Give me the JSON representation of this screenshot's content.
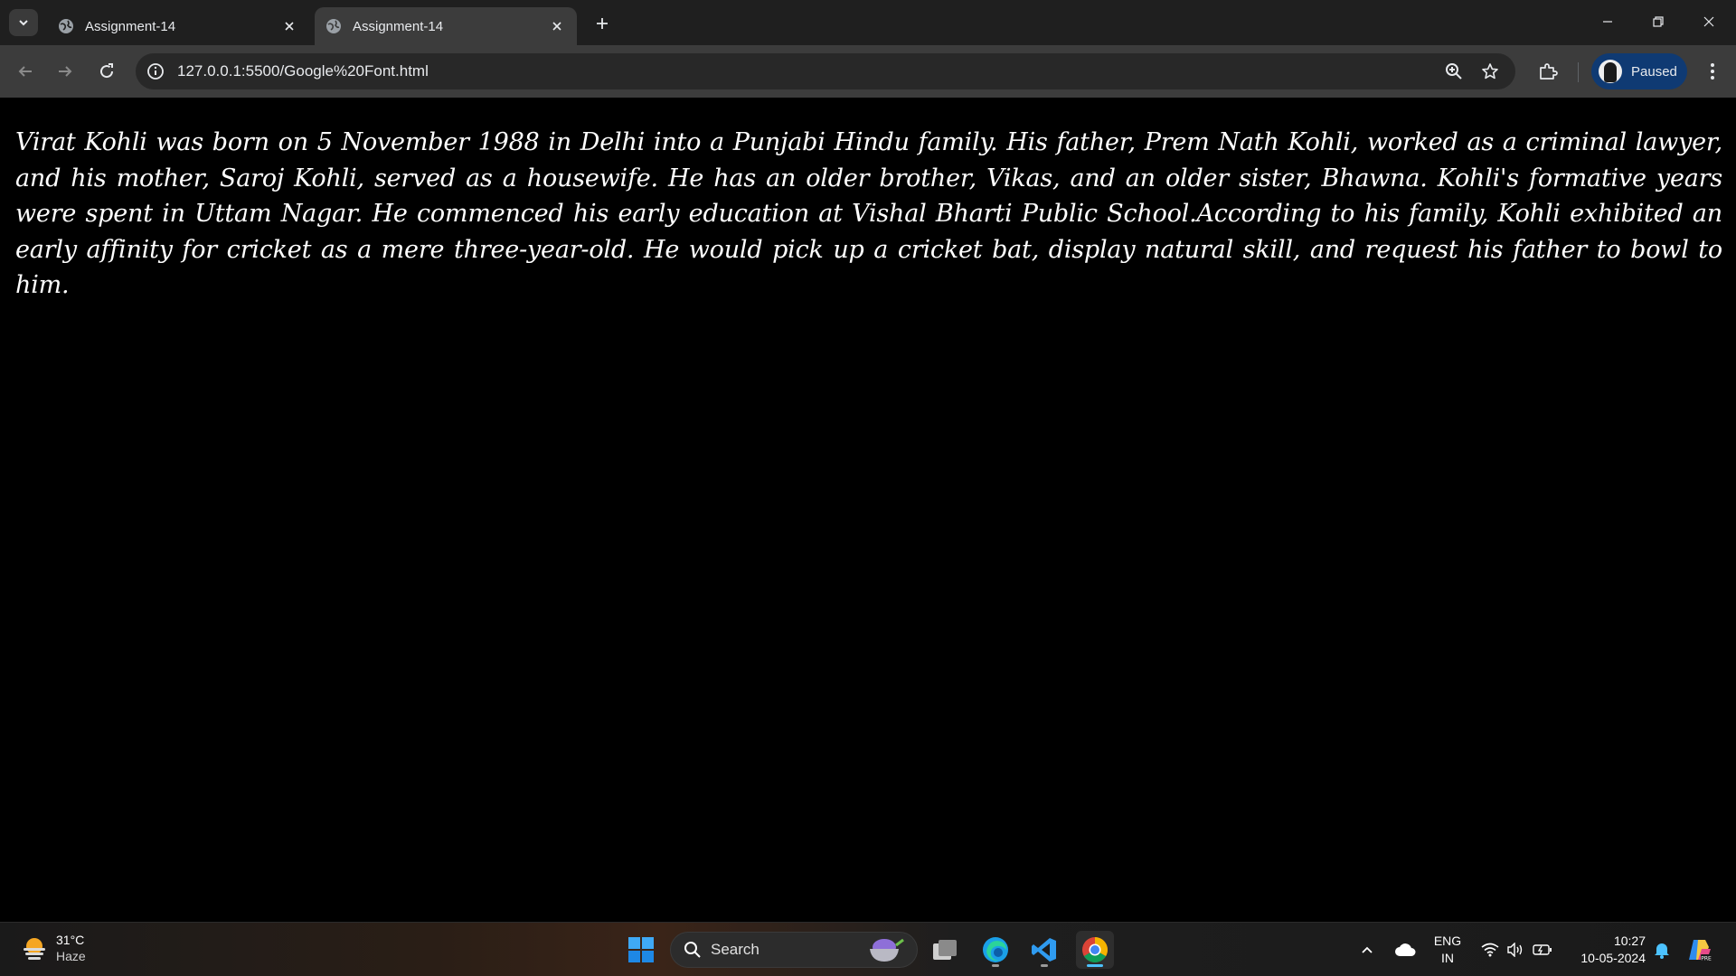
{
  "browser": {
    "tabs": [
      {
        "title": "Assignment-14",
        "active": false
      },
      {
        "title": "Assignment-14",
        "active": true
      }
    ],
    "url": "127.0.0.1:5500/Google%20Font.html",
    "profile_status": "Paused"
  },
  "page": {
    "paragraph": "Virat Kohli was born on 5 November 1988 in Delhi into a Punjabi Hindu family. His father, Prem Nath Kohli, worked as a criminal lawyer, and his mother, Saroj Kohli, served as a housewife. He has an older brother, Vikas, and an older sister, Bhawna. Kohli's formative years were spent in Uttam Nagar. He commenced his early education at Vishal Bharti Public School.According to his family, Kohli exhibited an early affinity for cricket as a mere three-year-old. He would pick up a cricket bat, display natural skill, and request his father to bowl to him."
  },
  "taskbar": {
    "weather": {
      "temperature": "31°C",
      "condition": "Haze"
    },
    "search_label": "Search",
    "language": {
      "line1": "ENG",
      "line2": "IN"
    },
    "clock": {
      "time": "10:27",
      "date": "10-05-2024"
    }
  },
  "colors": {
    "tabstrip_bg": "#1f1f1f",
    "toolbar_bg": "#3c3c3c",
    "page_bg": "#000000",
    "text": "#ffffff",
    "profile_bg": "#0f3a73"
  }
}
